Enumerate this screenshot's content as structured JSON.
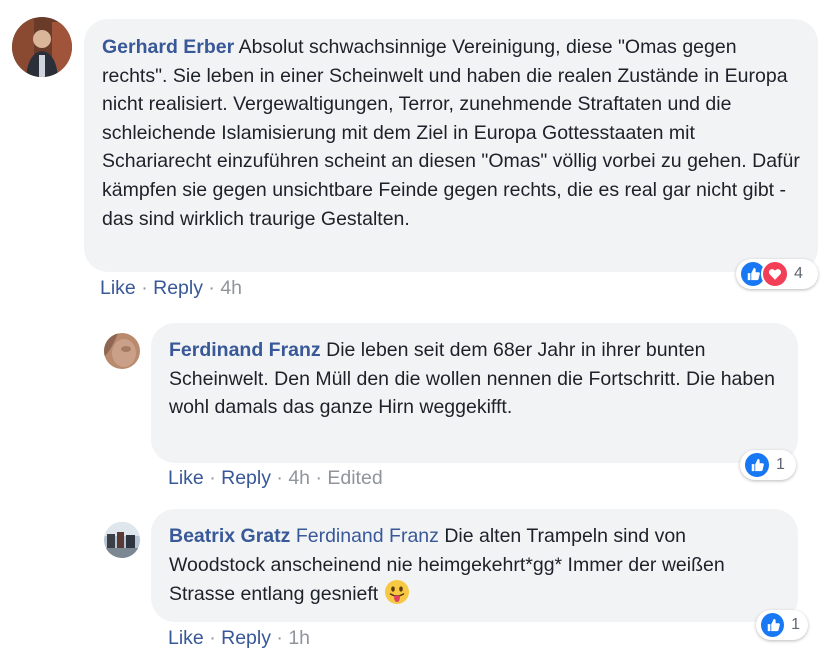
{
  "comments": [
    {
      "author": "Gerhard Erber",
      "text": "Absolut schwachsinnige Vereinigung, diese \"Omas gegen rechts\". Sie leben in einer Scheinwelt und haben die realen Zustände in Europa nicht realisiert. Vergewaltigungen, Terror, zunehmende Straftaten und die schleichende Islamisierung mit dem Ziel in Europa Gottesstaaten mit Schariarecht einzuführen scheint an diesen \"Omas\" völlig vorbei zu gehen. Dafür kämpfen sie gegen unsichtbare Feinde gegen rechts, die es real gar nicht gibt - das sind wirklich traurige Gestalten.",
      "like_label": "Like",
      "reply_label": "Reply",
      "time": "4h",
      "reactions": {
        "icons": [
          "like-icon",
          "love-icon"
        ],
        "count": "4"
      }
    },
    {
      "author": "Ferdinand Franz",
      "text": "Die leben seit dem 68er Jahr in ihrer bunten Scheinwelt. Den Müll den die wollen nennen die Fortschritt. Die haben wohl damals das ganze Hirn weggekifft.",
      "like_label": "Like",
      "reply_label": "Reply",
      "time": "4h",
      "edited_label": "Edited",
      "reactions": {
        "icons": [
          "like-icon"
        ],
        "count": "1"
      }
    },
    {
      "author": "Beatrix Gratz",
      "mention": "Ferdinand Franz",
      "text": "Die alten Trampeln sind von Woodstock anscheinend nie heimgekehrt*gg* Immer der weißen Strasse entlang gesnieft",
      "emoji": "tongue-out-emoji",
      "like_label": "Like",
      "reply_label": "Reply",
      "time": "1h",
      "reactions": {
        "icons": [
          "like-icon"
        ],
        "count": "1"
      }
    }
  ],
  "colors": {
    "name": "#385898",
    "bubble": "#f2f3f5",
    "meta": "#90949c",
    "like": "#1877f2",
    "love": "#f33e58"
  }
}
